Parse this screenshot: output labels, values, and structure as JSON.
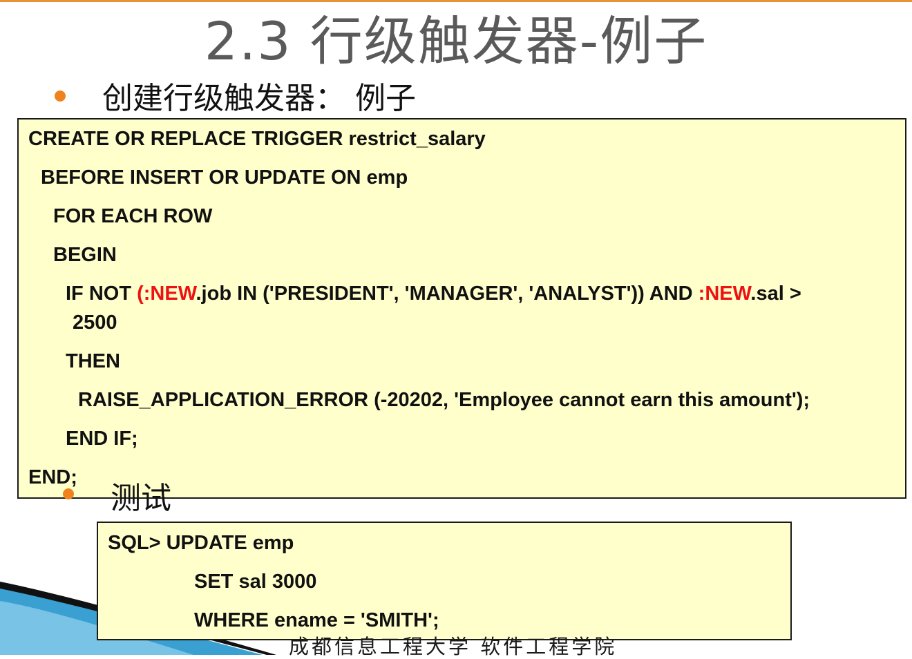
{
  "slide": {
    "title": "2.3 行级触发器-例子",
    "footer": "成都信息工程大学   软件工程学院"
  },
  "bullets": [
    {
      "text": "创建行级触发器：  例子"
    },
    {
      "text": "测试"
    }
  ],
  "trigger_code": {
    "line1": "CREATE OR REPLACE TRIGGER restrict_salary",
    "line2": "BEFORE INSERT OR UPDATE ON emp",
    "line3": "FOR EACH ROW",
    "line4": "BEGIN",
    "line5": {
      "p1": "IF NOT ",
      "p2": "(:NEW",
      "p3": ".job IN ('PRESIDENT', 'MANAGER', 'ANALYST')) AND ",
      "p4": ":NEW",
      "p5": ".sal >"
    },
    "line5_cont": "2500",
    "line6": "THEN",
    "line7": "RAISE_APPLICATION_ERROR (-20202, 'Employee cannot earn this amount');",
    "line8": "END IF;",
    "line9": "END;"
  },
  "test_code": {
    "line1": "SQL> UPDATE emp",
    "line2": "SET sal 3000",
    "line3": "WHERE ename = 'SMITH';"
  },
  "colors": {
    "accent": "#f0821e",
    "code_bg": "#ffffcc",
    "keyword_new": "#ee1111",
    "decor_blue": "#3aa0d2"
  }
}
